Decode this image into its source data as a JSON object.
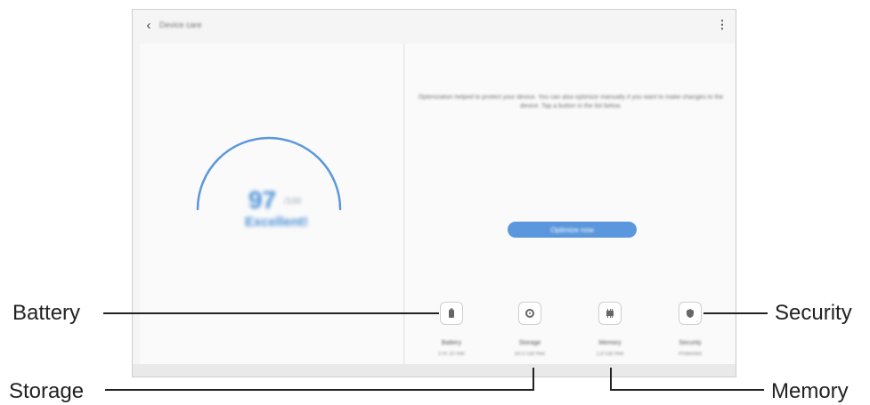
{
  "header": {
    "title": "Device care",
    "back_icon": "arrow-back-icon",
    "menu_icon": "more-options-icon"
  },
  "score_panel": {
    "score": "97",
    "unit": "/100",
    "status": "Excellent!",
    "gauge_color": "#5b97dc",
    "gauge_level_percent": 97
  },
  "optimize_panel": {
    "description": "Optimization helped to protect your device. You can also optimize manually if you want to make changes to the device. Tap a button in the list below.",
    "button_label": "Optimize now"
  },
  "items": [
    {
      "name": "Battery",
      "value": "3 hr 20 min",
      "icon": "battery-icon"
    },
    {
      "name": "Storage",
      "value": "50.0 GB free",
      "icon": "storage-icon"
    },
    {
      "name": "Memory",
      "value": "1.8 GB free",
      "icon": "memory-icon"
    },
    {
      "name": "Security",
      "value": "Protected",
      "icon": "shield-icon"
    }
  ],
  "callouts": {
    "battery": "Battery",
    "storage": "Storage",
    "security": "Security",
    "memory": "Memory"
  },
  "colors": {
    "accent": "#5b97dc",
    "background": "#f5f5f5"
  }
}
